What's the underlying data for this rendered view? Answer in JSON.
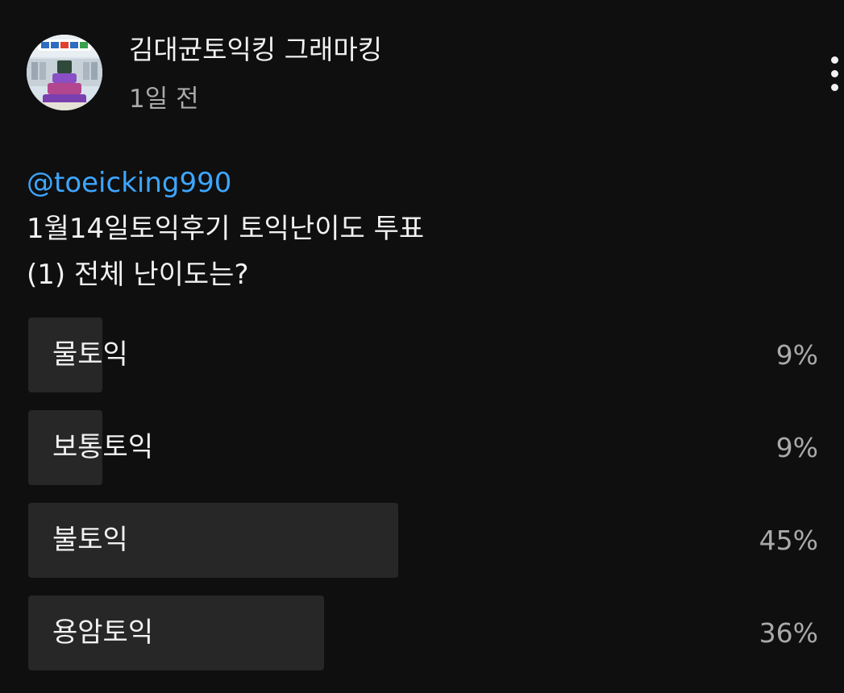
{
  "post": {
    "channel_name": "김대균토익킹 그래마킹",
    "time_ago": "1일 전",
    "menu_icon": "more-vertical-icon",
    "mention": "@toeicking990",
    "lines": [
      "1월14일토익후기 토익난이도 투표",
      "(1) 전체 난이도는?"
    ]
  },
  "poll": {
    "options": [
      {
        "label": "물토익",
        "percent_text": "9%",
        "percent": 9
      },
      {
        "label": "보통토익",
        "percent_text": "9%",
        "percent": 9
      },
      {
        "label": "불토익",
        "percent_text": "45%",
        "percent": 45
      },
      {
        "label": "용암토익",
        "percent_text": "36%",
        "percent": 36
      }
    ]
  },
  "colors": {
    "background": "#0f0f0f",
    "text": "#f1f1f1",
    "secondary_text": "#aaaaaa",
    "mention": "#3ea6ff",
    "poll_fill": "#272727"
  }
}
